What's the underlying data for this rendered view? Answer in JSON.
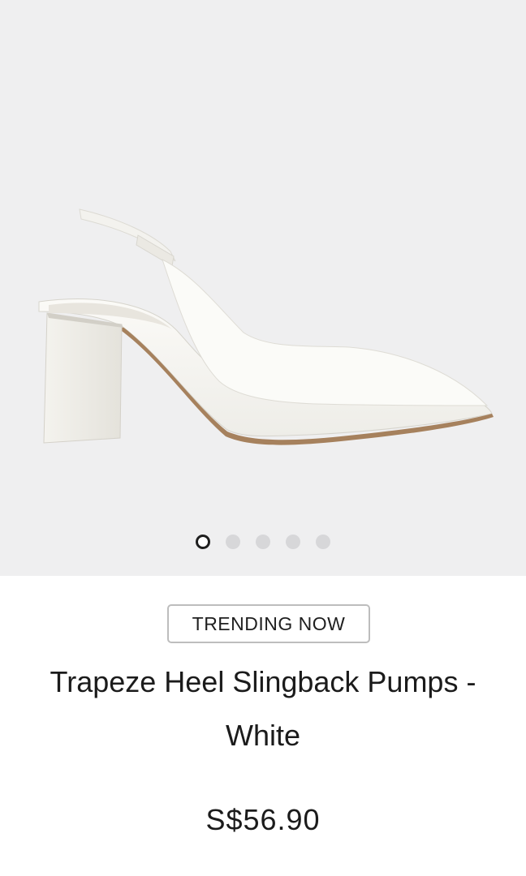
{
  "gallery": {
    "image_label": "white-slingback-pump-icon",
    "dots": [
      {
        "label": "image-1",
        "active": true
      },
      {
        "label": "image-2",
        "active": false
      },
      {
        "label": "image-3",
        "active": false
      },
      {
        "label": "image-4",
        "active": false
      },
      {
        "label": "image-5",
        "active": false
      }
    ],
    "background_color": "#efeff0"
  },
  "product": {
    "badge": "TRENDING NOW",
    "title": "Trapeze Heel Slingback Pumps - White",
    "price": "S$56.90"
  }
}
